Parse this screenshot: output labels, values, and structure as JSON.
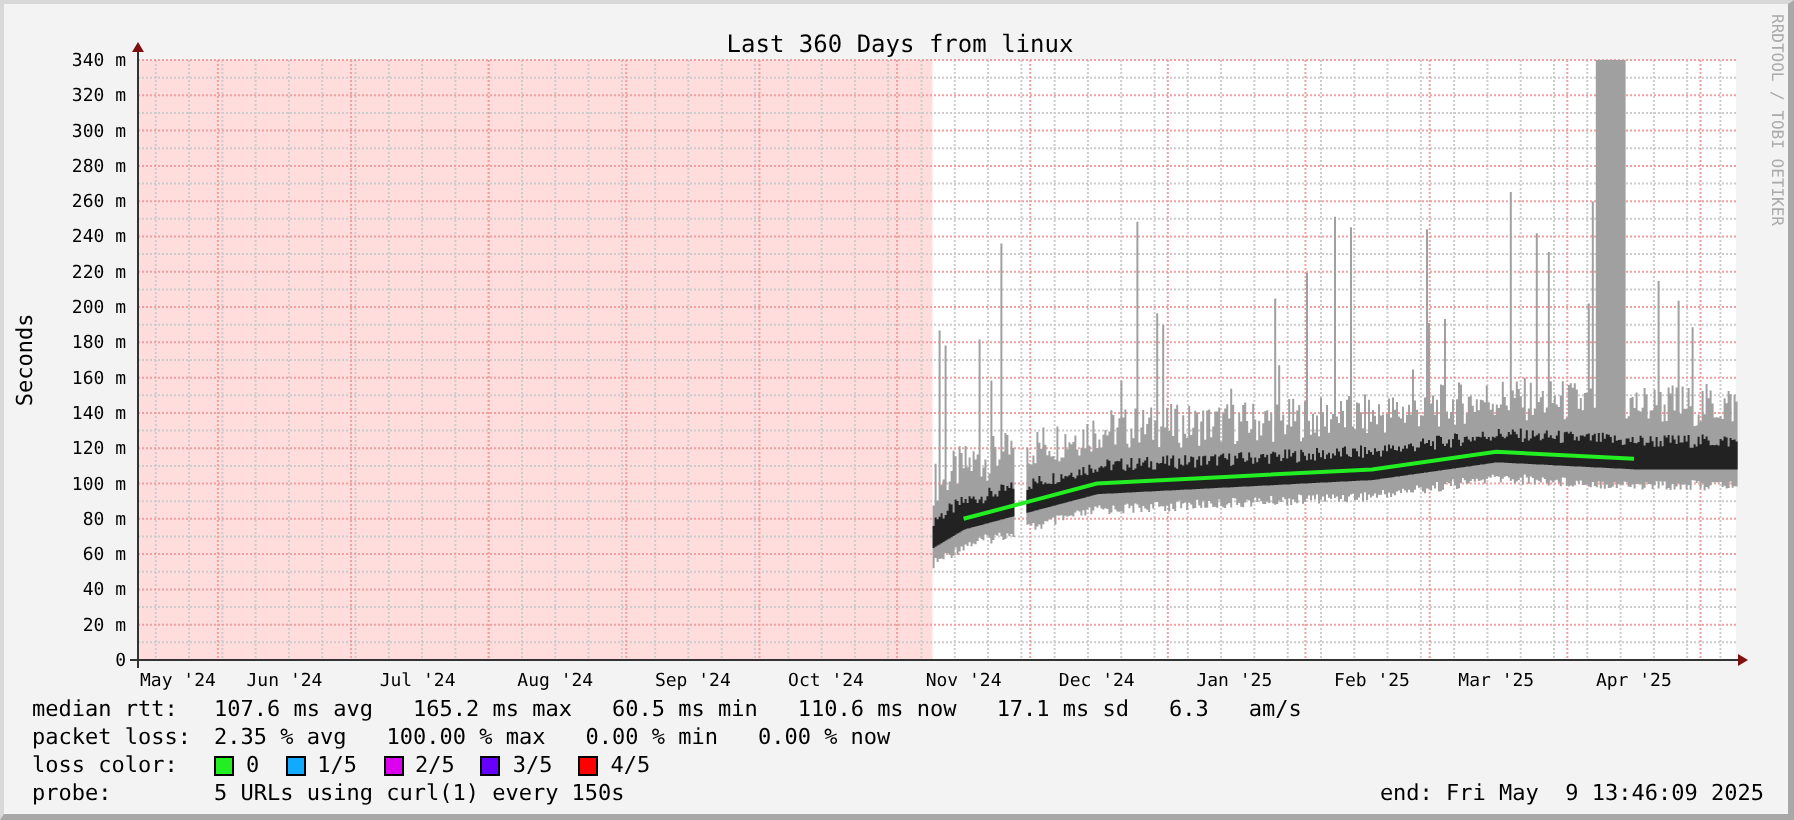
{
  "graph": {
    "credit": "RRDTOOL / TOBI OETIKER",
    "chart_data": {
      "type": "line",
      "title": "Last 360 Days from linux",
      "ylabel": "Seconds",
      "categories": [
        "May '24",
        "Jun '24",
        "Jul '24",
        "Aug '24",
        "Sep '24",
        "Oct '24",
        "Nov '24",
        "Dec '24",
        "Jan '25",
        "Feb '25",
        "Mar '25",
        "Apr '25"
      ],
      "grid": true,
      "series": [
        {
          "name": "median rtt:",
          "color": "#22ee22",
          "values": [
            null,
            null,
            null,
            null,
            null,
            null,
            80,
            100,
            104,
            108,
            118,
            114
          ]
        }
      ],
      "ylim": [
        0,
        340
      ],
      "yticks": [
        {
          "value": 0,
          "label": "0"
        },
        {
          "value": 20,
          "label": "20 m"
        },
        {
          "value": 40,
          "label": "40 m"
        },
        {
          "value": 60,
          "label": "60 m"
        },
        {
          "value": 80,
          "label": "80 m"
        },
        {
          "value": 100,
          "label": "100 m"
        },
        {
          "value": 120,
          "label": "120 m"
        },
        {
          "value": 140,
          "label": "140 m"
        },
        {
          "value": 160,
          "label": "160 m"
        },
        {
          "value": 180,
          "label": "180 m"
        },
        {
          "value": 200,
          "label": "200 m"
        },
        {
          "value": 220,
          "label": "220 m"
        },
        {
          "value": 240,
          "label": "240 m"
        },
        {
          "value": 260,
          "label": "260 m"
        },
        {
          "value": 280,
          "label": "280 m"
        },
        {
          "value": 300,
          "label": "300 m"
        },
        {
          "value": 320,
          "label": "320 m"
        },
        {
          "value": 340,
          "label": "340 m"
        }
      ]
    }
  },
  "legend": {
    "median_rtt": {
      "values": [
        "107.6 ms avg",
        "165.2 ms max",
        "60.5 ms min",
        "110.6 ms now",
        "17.1 ms sd",
        "6.3",
        "am/s"
      ]
    },
    "packet_loss": {
      "label": "packet loss:",
      "values": [
        "2.35 % avg",
        "100.00 % max",
        "0.00 % min",
        "0.00 % now"
      ]
    },
    "loss_color": {
      "label": "loss color:",
      "items": [
        {
          "label": "0",
          "color": "#22ee22"
        },
        {
          "label": "1/5",
          "color": "#11aaff"
        },
        {
          "label": "2/5",
          "color": "#dd00ee"
        },
        {
          "label": "3/5",
          "color": "#6600ff"
        },
        {
          "label": "4/5",
          "color": "#ff0000"
        }
      ]
    },
    "probe": {
      "label": "probe:",
      "value": "5 URLs using curl(1) every 150s"
    },
    "end": "end: Fri May  9 13:46:09 2025"
  }
}
